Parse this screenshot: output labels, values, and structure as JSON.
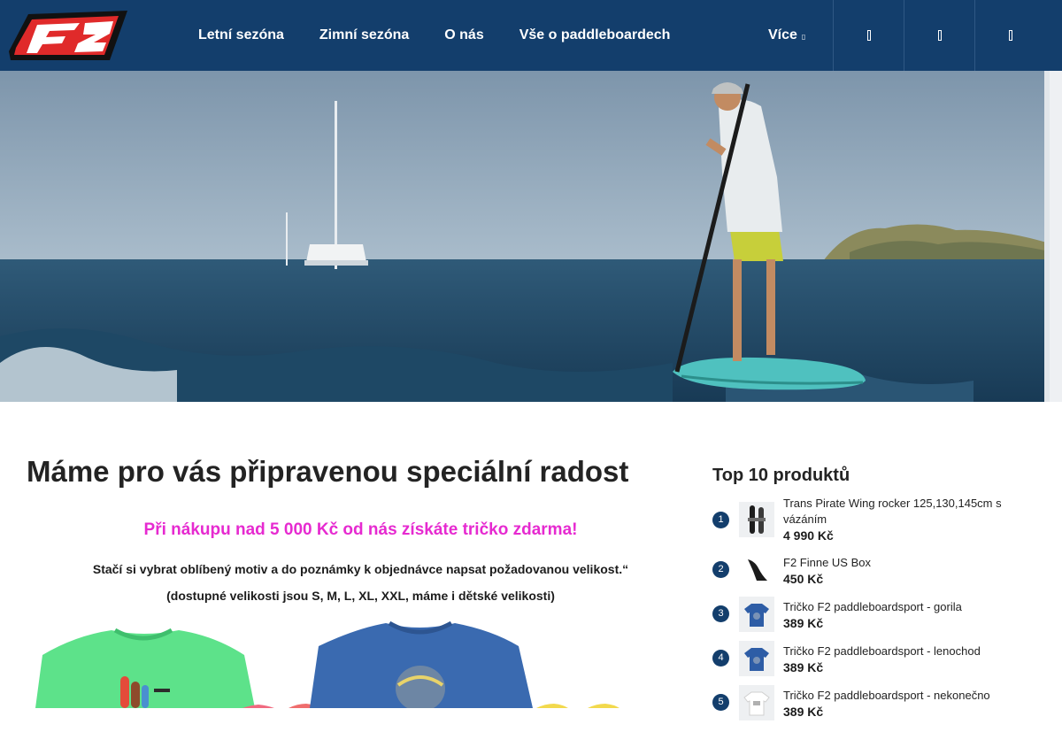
{
  "header": {
    "nav": [
      "Letní sezóna",
      "Zimní sezóna",
      "O nás",
      "Vše o paddleboardech"
    ],
    "more_label": "Více",
    "icons": [
      "search-icon",
      "user-icon",
      "cart-icon"
    ]
  },
  "promo": {
    "title": "Máme pro vás připravenou speciální radost",
    "subtitle": "Při nákupu nad 5 000 Kč od nás získáte tričko zdarma!",
    "text": "Stačí si vybrat oblíbený motiv a do poznámky k objednávce napsat požadovanou velikost.“",
    "sizes": "(dostupné velikosti jsou S, M, L, XL, XXL, máme i dětské velikosti)"
  },
  "top10": {
    "title": "Top 10 produktů",
    "items": [
      {
        "rank": "1",
        "name": "Trans Pirate Wing rocker 125,130,145cm s vázáním",
        "price": "4 990 Kč"
      },
      {
        "rank": "2",
        "name": "F2 Finne US Box",
        "price": "450 Kč"
      },
      {
        "rank": "3",
        "name": "Tričko F2 paddleboardsport - gorila",
        "price": "389 Kč"
      },
      {
        "rank": "4",
        "name": "Tričko F2 paddleboardsport - lenochod",
        "price": "389 Kč"
      },
      {
        "rank": "5",
        "name": "Tričko F2 paddleboardsport - nekonečno",
        "price": "389 Kč"
      }
    ]
  },
  "colors": {
    "header_bg": "#133e6c",
    "accent_pink": "#e62ad0",
    "logo_red": "#e02a2a"
  }
}
